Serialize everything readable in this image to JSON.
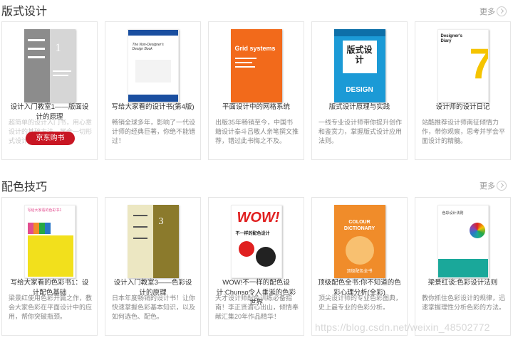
{
  "sections": [
    {
      "title": "版式设计",
      "more_label": "更多",
      "books": [
        {
          "title": "设计入门教室1——版面设计的原理",
          "desc": "超简单的设计入门书，用心意设计的基础方法，学会一切形式设计基础",
          "buy_label": "京东购书",
          "cover": {
            "bg": "#d9d9d9",
            "spine": "#8a8a8a",
            "accent": "#ffffff",
            "text1": "1",
            "text2": ""
          }
        },
        {
          "title": "写给大家看的设计书(第4版)",
          "desc": "畅销全球多年，影响了一代设计师的经典巨著，你绝不能错过！",
          "cover": {
            "bg": "#ffffff",
            "spine": "#1a4fa0",
            "accent": "#3a3a3a",
            "text1": "The Non-Designer's Design Book",
            "text2": ""
          }
        },
        {
          "title": "平面设计中的网格系统",
          "desc": "出版35年畅销至今，中国书籍设计泰斗吕敬人亲笔撰文推荐，错过此书悔之不及。",
          "cover": {
            "bg": "#f26a1b",
            "spine": "#f26a1b",
            "accent": "#ffffff",
            "text1": "Grid systems",
            "text2": ""
          }
        },
        {
          "title": "版式设计原理与实践",
          "desc": "一线专业设计师带你提升创作和鉴赏力，掌握版式设计应用法则。",
          "cover": {
            "bg": "#1b9ad6",
            "spine": "#1b9ad6",
            "accent": "#ffffff",
            "text1": "版式设计",
            "text2": "DESIGN"
          }
        },
        {
          "title": "设计师的设计日记",
          "desc": "站酷推荐设计师南征倾情力作，带你观察，思考并学会平面设计的精髓。",
          "cover": {
            "bg": "#ffffff",
            "spine": "#f5c400",
            "accent": "#f5c400",
            "text1": "Designer's Diary",
            "text2": "7"
          }
        }
      ]
    },
    {
      "title": "配色技巧",
      "more_label": "更多",
      "books": [
        {
          "title": "写给大家看的色彩书1：设计配色基础",
          "desc": "梁景红使用色彩开篇之作，教会大家色彩在平面设计中的应用，帮你突破瓶颈。",
          "cover": {
            "bg": "#ffffff",
            "spine": "#f2e01c",
            "accent": "#e24d8f",
            "text1": "写给大家看的色彩书1",
            "text2": ""
          }
        },
        {
          "title": "设计入门教室3——色彩设计的原理",
          "desc": "日本年度畅销的设计书！让你快速掌握色彩基本知识，以及如何选色、配色。",
          "cover": {
            "bg": "#f4f0d6",
            "spine": "#8b7a2c",
            "accent": "#ffffff",
            "text1": "3",
            "text2": ""
          }
        },
        {
          "title": "WOW!不一样的配色设计:Chunso令人垂涎的色彩世界",
          "desc": "天才设计师配色训练必备指南！李正贤潜心出山，倾情奉献汇集20年作品精华！",
          "cover": {
            "bg": "#ffffff",
            "spine": "#e02020",
            "accent": "#e02020",
            "text1": "WOW!",
            "text2": "不一样的配色设计"
          }
        },
        {
          "title": "顶级配色全书:你不知道的色彩心理分析(全彩)",
          "desc": "顶尖设计师的专业色彩图典，史上最专业的色彩分析。",
          "cover": {
            "bg": "#f08c2a",
            "spine": "#f08c2a",
            "accent": "#ffffff",
            "text1": "COLOUR DICTIONARY",
            "text2": "顶级配色全书"
          }
        },
        {
          "title": "梁景红谈:色彩设计法则",
          "desc": "教你抓住色彩设计的规律，迅速掌握理性分析色彩的方法。",
          "cover": {
            "bg": "#ffffff",
            "spine": "#1aa89a",
            "accent": "#1aa89a",
            "text1": "色彩设计法则",
            "text2": ""
          }
        }
      ]
    }
  ],
  "watermark": "https://blog.csdn.net/weixin_48502772"
}
